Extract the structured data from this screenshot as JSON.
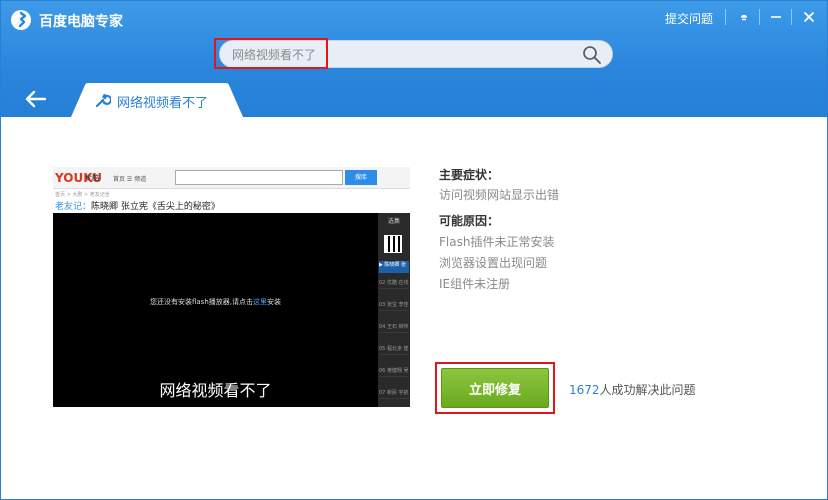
{
  "app": {
    "title": "百度电脑专家"
  },
  "header": {
    "submit_label": "提交问题",
    "search": {
      "value": "",
      "placeholder": "网络视频看不了"
    }
  },
  "icons": {
    "logo": "baidu-expert-logo",
    "menu": "chevron-down-icon",
    "minimize": "minimize-icon",
    "close": "close-icon",
    "search": "search-icon",
    "back": "back-arrow-icon",
    "tab": "wrench-icon"
  },
  "tab": {
    "label": "网络视频看不了"
  },
  "preview": {
    "logo": "YOUKU",
    "logo_sub": "优酷",
    "nav": "首页   ☰ 频道",
    "search_button": "搜库",
    "breadcrumb": "首页 > 大剧 > 老友记全",
    "title_accent": "老友记：",
    "title_rest": "陈晓卿 张立宪《舌尖上的秘密》",
    "message_prefix": "您还没有安装flash播放器,请点击",
    "message_link": "这里",
    "message_suffix": "安装",
    "overlay": "网络视频看不了",
    "side_head": "选集",
    "side_active": "▶ 陈晓卿 张",
    "side_items": [
      "02 优酷 在线",
      "03 张宝 李佳",
      "04 王石 柳传",
      "05 程北京 崔",
      "06 黄健翔 吴",
      "07 新民 宇航"
    ]
  },
  "symptoms": {
    "heading": "主要症状：",
    "items": [
      "访问视频网站显示出错"
    ]
  },
  "causes": {
    "heading": "可能原因：",
    "items": [
      "Flash插件未正常安装",
      "浏览器设置出现问题",
      "IE组件未注册"
    ]
  },
  "action": {
    "fix_label": "立即修复",
    "count": "1672",
    "count_suffix": "人成功解决此问题"
  },
  "colors": {
    "header": "#2a85dc",
    "accent": "#2a7fd6",
    "fix_button": "#7ab92d",
    "highlight": "#e0161b"
  }
}
